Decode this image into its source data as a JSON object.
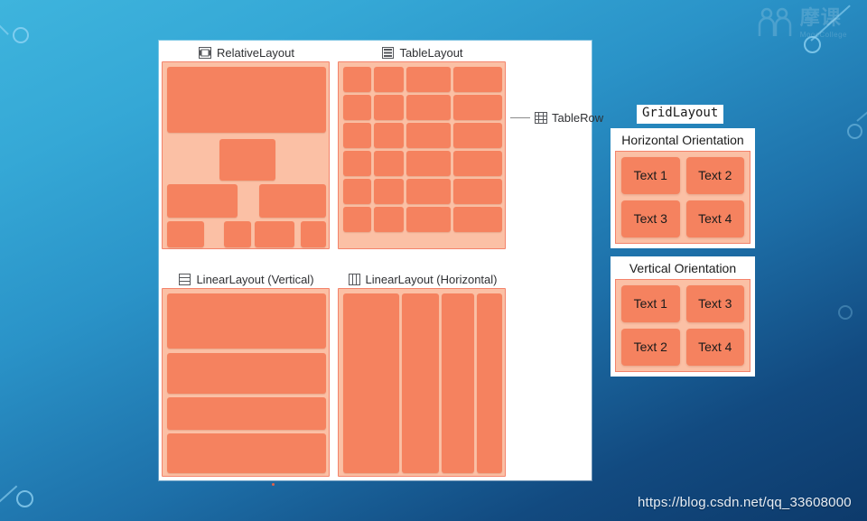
{
  "page": {
    "url_text": "https://blog.csdn.net/qq_33608000",
    "watermark_text": "摩课",
    "watermark_sub": "MoocCollege"
  },
  "diagram": {
    "blocks": [
      {
        "id": "relative-layout",
        "title": "RelativeLayout",
        "icon": "relative-layout-icon"
      },
      {
        "id": "table-layout",
        "title": "TableLayout",
        "icon": "table-layout-icon"
      },
      {
        "id": "linear-layout-vertical",
        "title": "LinearLayout (Vertical)",
        "icon": "linear-layout-vertical-icon"
      },
      {
        "id": "linear-layout-horizontal",
        "title": "LinearLayout (Horizontal)",
        "icon": "linear-layout-horizontal-icon"
      }
    ],
    "callout": {
      "label": "TableRow",
      "icon": "table-row-icon"
    }
  },
  "grid_layout": {
    "title": "GridLayout",
    "panels": [
      {
        "id": "horizontal-orientation",
        "title": "Horizontal Orientation",
        "cells": [
          "Text 1",
          "Text 2",
          "Text 3",
          "Text 4"
        ]
      },
      {
        "id": "vertical-orientation",
        "title": "Vertical Orientation",
        "cells": [
          "Text 1",
          "Text 3",
          "Text 2",
          "Text 4"
        ]
      }
    ]
  },
  "colors": {
    "cell_fill": "#F5825F",
    "container_fill": "#FBC0A5",
    "container_border": "#F4836B",
    "panel_background": "#FFFFFF",
    "backdrop_top": "#3EB4DD",
    "backdrop_bottom": "#0D3A6B",
    "url_text": "#E8EEF5"
  }
}
